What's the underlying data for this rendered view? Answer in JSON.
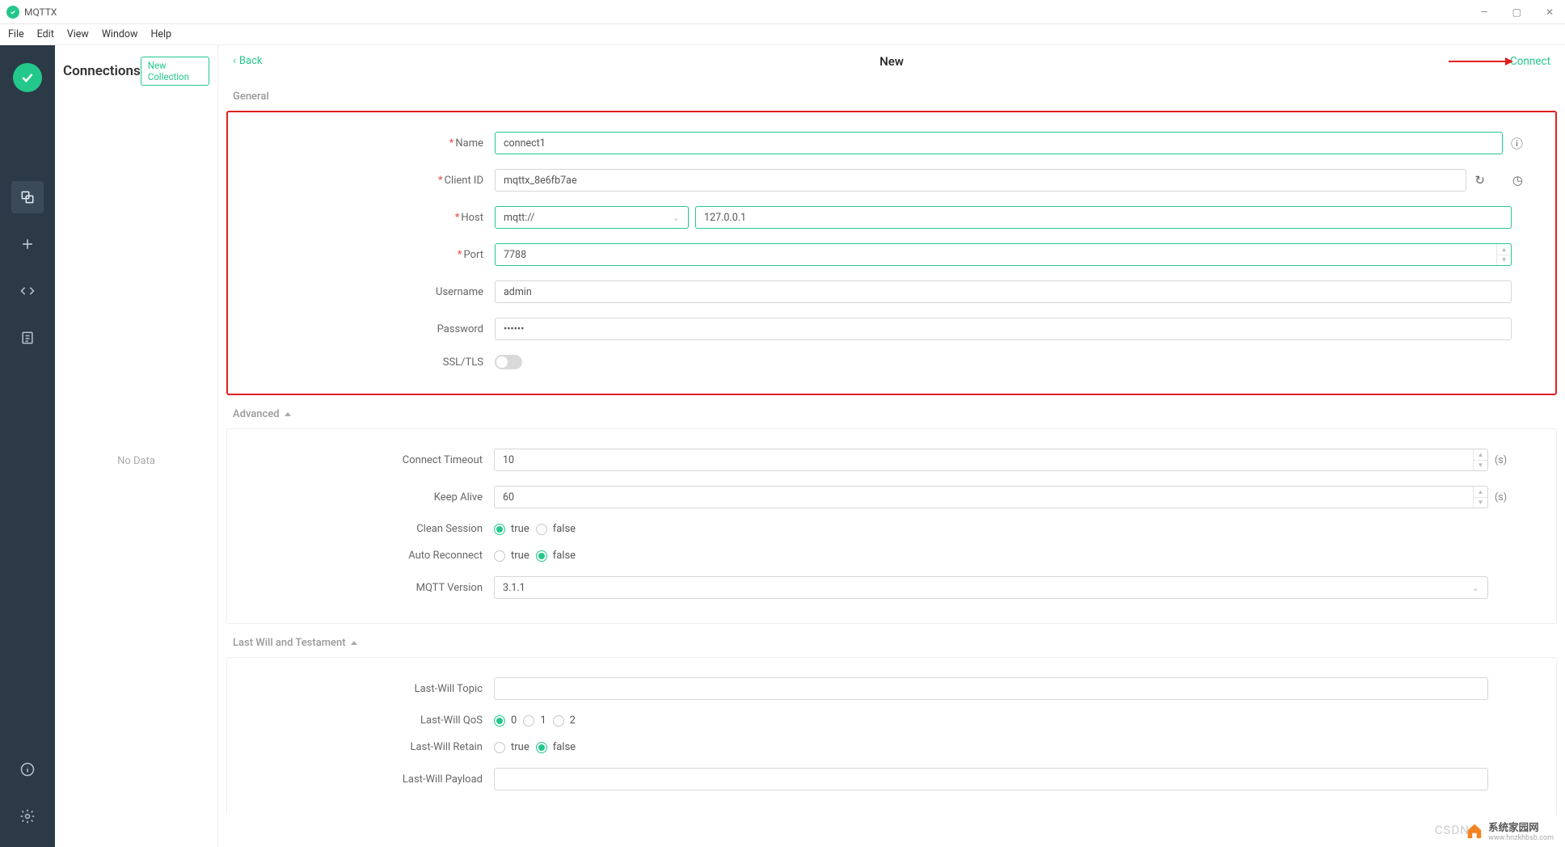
{
  "app": {
    "title": "MQTTX"
  },
  "menu": {
    "file": "File",
    "edit": "Edit",
    "view": "View",
    "window": "Window",
    "help": "Help"
  },
  "windowControls": {
    "min": "—",
    "max": "▢",
    "close": "✕"
  },
  "sidebar": {
    "title": "Connections",
    "newCollection": "New Collection",
    "noData": "No Data"
  },
  "topbar": {
    "back": "Back",
    "pageTitle": "New",
    "connect": "Connect"
  },
  "sections": {
    "general": "General",
    "advanced": "Advanced",
    "lastwill": "Last Will and Testament"
  },
  "general": {
    "nameLabel": "Name",
    "nameValue": "connect1",
    "clientIdLabel": "Client ID",
    "clientIdValue": "mqttx_8e6fb7ae",
    "hostLabel": "Host",
    "hostScheme": "mqtt://",
    "hostValue": "127.0.0.1",
    "portLabel": "Port",
    "portValue": "7788",
    "usernameLabel": "Username",
    "usernameValue": "admin",
    "passwordLabel": "Password",
    "passwordValue": "••••••",
    "sslLabel": "SSL/TLS",
    "sslOn": false
  },
  "advanced": {
    "connectTimeoutLabel": "Connect Timeout",
    "connectTimeoutValue": "10",
    "unitSeconds": "(s)",
    "keepAliveLabel": "Keep Alive",
    "keepAliveValue": "60",
    "cleanSessionLabel": "Clean Session",
    "cleanSessionTrue": "true",
    "cleanSessionFalse": "false",
    "cleanSessionSelected": "true",
    "autoReconnectLabel": "Auto Reconnect",
    "autoReconnectTrue": "true",
    "autoReconnectFalse": "false",
    "autoReconnectSelected": "false",
    "mqttVersionLabel": "MQTT Version",
    "mqttVersionValue": "3.1.1"
  },
  "lastwill": {
    "topicLabel": "Last-Will Topic",
    "topicValue": "",
    "qosLabel": "Last-Will QoS",
    "qos0": "0",
    "qos1": "1",
    "qos2": "2",
    "qosSelected": "0",
    "retainLabel": "Last-Will Retain",
    "retainTrue": "true",
    "retainFalse": "false",
    "retainSelected": "false",
    "payloadLabel": "Last-Will Payload",
    "payloadValue": ""
  },
  "icons": {
    "info": "ⓘ",
    "refresh": "↻",
    "history": "◷"
  },
  "watermark": {
    "csdn": "CSDN",
    "siteName": "系统家园网",
    "siteUrl": "www.hnzkhbsb.com"
  }
}
